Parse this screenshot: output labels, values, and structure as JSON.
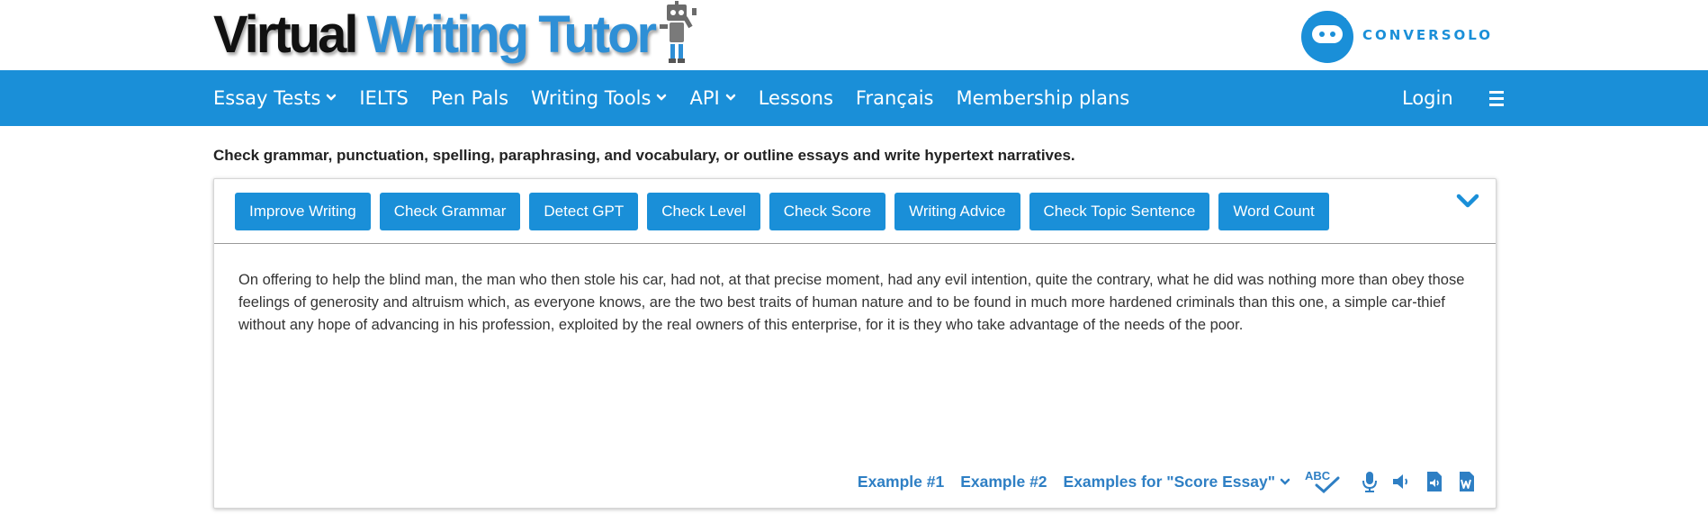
{
  "header": {
    "logo_word1": "Virtual",
    "logo_word2": "Writing Tutor",
    "partner_name": "CONVERSOLO"
  },
  "nav": {
    "items": [
      {
        "label": "Essay Tests",
        "dropdown": true
      },
      {
        "label": "IELTS",
        "dropdown": false
      },
      {
        "label": "Pen Pals",
        "dropdown": false
      },
      {
        "label": "Writing Tools",
        "dropdown": true
      },
      {
        "label": "API",
        "dropdown": true
      },
      {
        "label": "Lessons",
        "dropdown": false
      },
      {
        "label": "Français",
        "dropdown": false
      },
      {
        "label": "Membership plans",
        "dropdown": false
      }
    ],
    "login": "Login",
    "menu_icon": "hamburger-menu-icon"
  },
  "tagline": "Check grammar, punctuation, spelling, paraphrasing, and vocabulary, or outline essays and write hypertext narratives.",
  "toolbar": {
    "buttons": [
      "Improve Writing",
      "Check Grammar",
      "Detect GPT",
      "Check Level",
      "Check Score",
      "Writing Advice",
      "Check Topic Sentence",
      "Word Count"
    ]
  },
  "editor": {
    "text": "On offering to help the blind man, the man who then stole his car, had not, at that precise moment, had any evil intention, quite the contrary, what he did was nothing more than obey those feelings of generosity and altruism which, as everyone knows, are the two best traits of human nature and to be found in much more hardened criminals than this one, a simple car-thief without any hope of advancing in his profession, exploited by the real owners of this enterprise, for it is they who take advantage of the needs of the poor."
  },
  "bottom_bar": {
    "example1": "Example #1",
    "example2": "Example #2",
    "examples_dropdown": "Examples for \"Score Essay\"",
    "spellcheck_label": "ABC"
  },
  "colors": {
    "brand_blue": "#1a8fd8",
    "link_blue": "#2e7fc4",
    "logo_blue": "#2e8fd6"
  }
}
